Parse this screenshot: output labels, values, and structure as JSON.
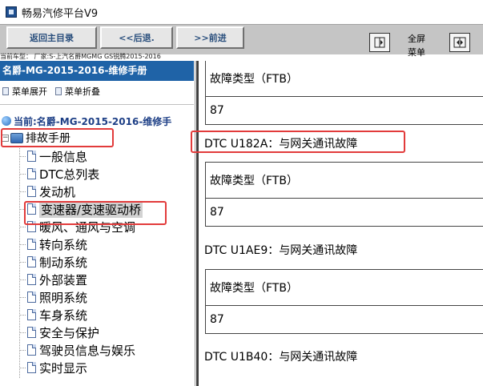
{
  "window": {
    "title": "畅易汽修平台V9"
  },
  "toolbar": {
    "back_home_label": "返回主目录",
    "back_label": "<<后退.",
    "forward_label": ">>前进",
    "fullscreen_label": "全屏",
    "menu_label": "菜单"
  },
  "vehicle": {
    "line": "当前车型：  厂家:S-上汽名爵MGMG GS锐腾2015-2016"
  },
  "sidebar": {
    "manual_title": "名爵-MG-2015-2016-维修手册",
    "expand_label": "菜单展开",
    "collapse_label": "菜单折叠",
    "current_label": "当前:名爵-MG-2015-2016-维修手",
    "tree_root": "排故手册",
    "items": [
      {
        "label": "一般信息"
      },
      {
        "label": "DTC总列表"
      },
      {
        "label": "发动机"
      },
      {
        "label": "变速器/变速驱动桥"
      },
      {
        "label": "暖风、通风与空调"
      },
      {
        "label": "转向系统"
      },
      {
        "label": "制动系统"
      },
      {
        "label": "外部装置"
      },
      {
        "label": "照明系统"
      },
      {
        "label": "车身系统"
      },
      {
        "label": "安全与保护"
      },
      {
        "label": "驾驶员信息与娱乐"
      },
      {
        "label": "实时显示"
      }
    ]
  },
  "content": {
    "first_block": {
      "type_label": "故障类型（FTB）",
      "value": "87"
    },
    "entries": [
      {
        "title": "DTC U182A：与网关通讯故障",
        "type_label": "故障类型（FTB）",
        "value": "87"
      },
      {
        "title": "DTC U1AE9：与网关通讯故障",
        "type_label": "故障类型（FTB）",
        "value": "87"
      },
      {
        "title": "DTC U1B40：与网关通讯故障"
      }
    ]
  },
  "colors": {
    "highlight": "#e23b3b",
    "header_bg": "#1f63a7",
    "toolbar_bg": "#c5c5c5"
  }
}
